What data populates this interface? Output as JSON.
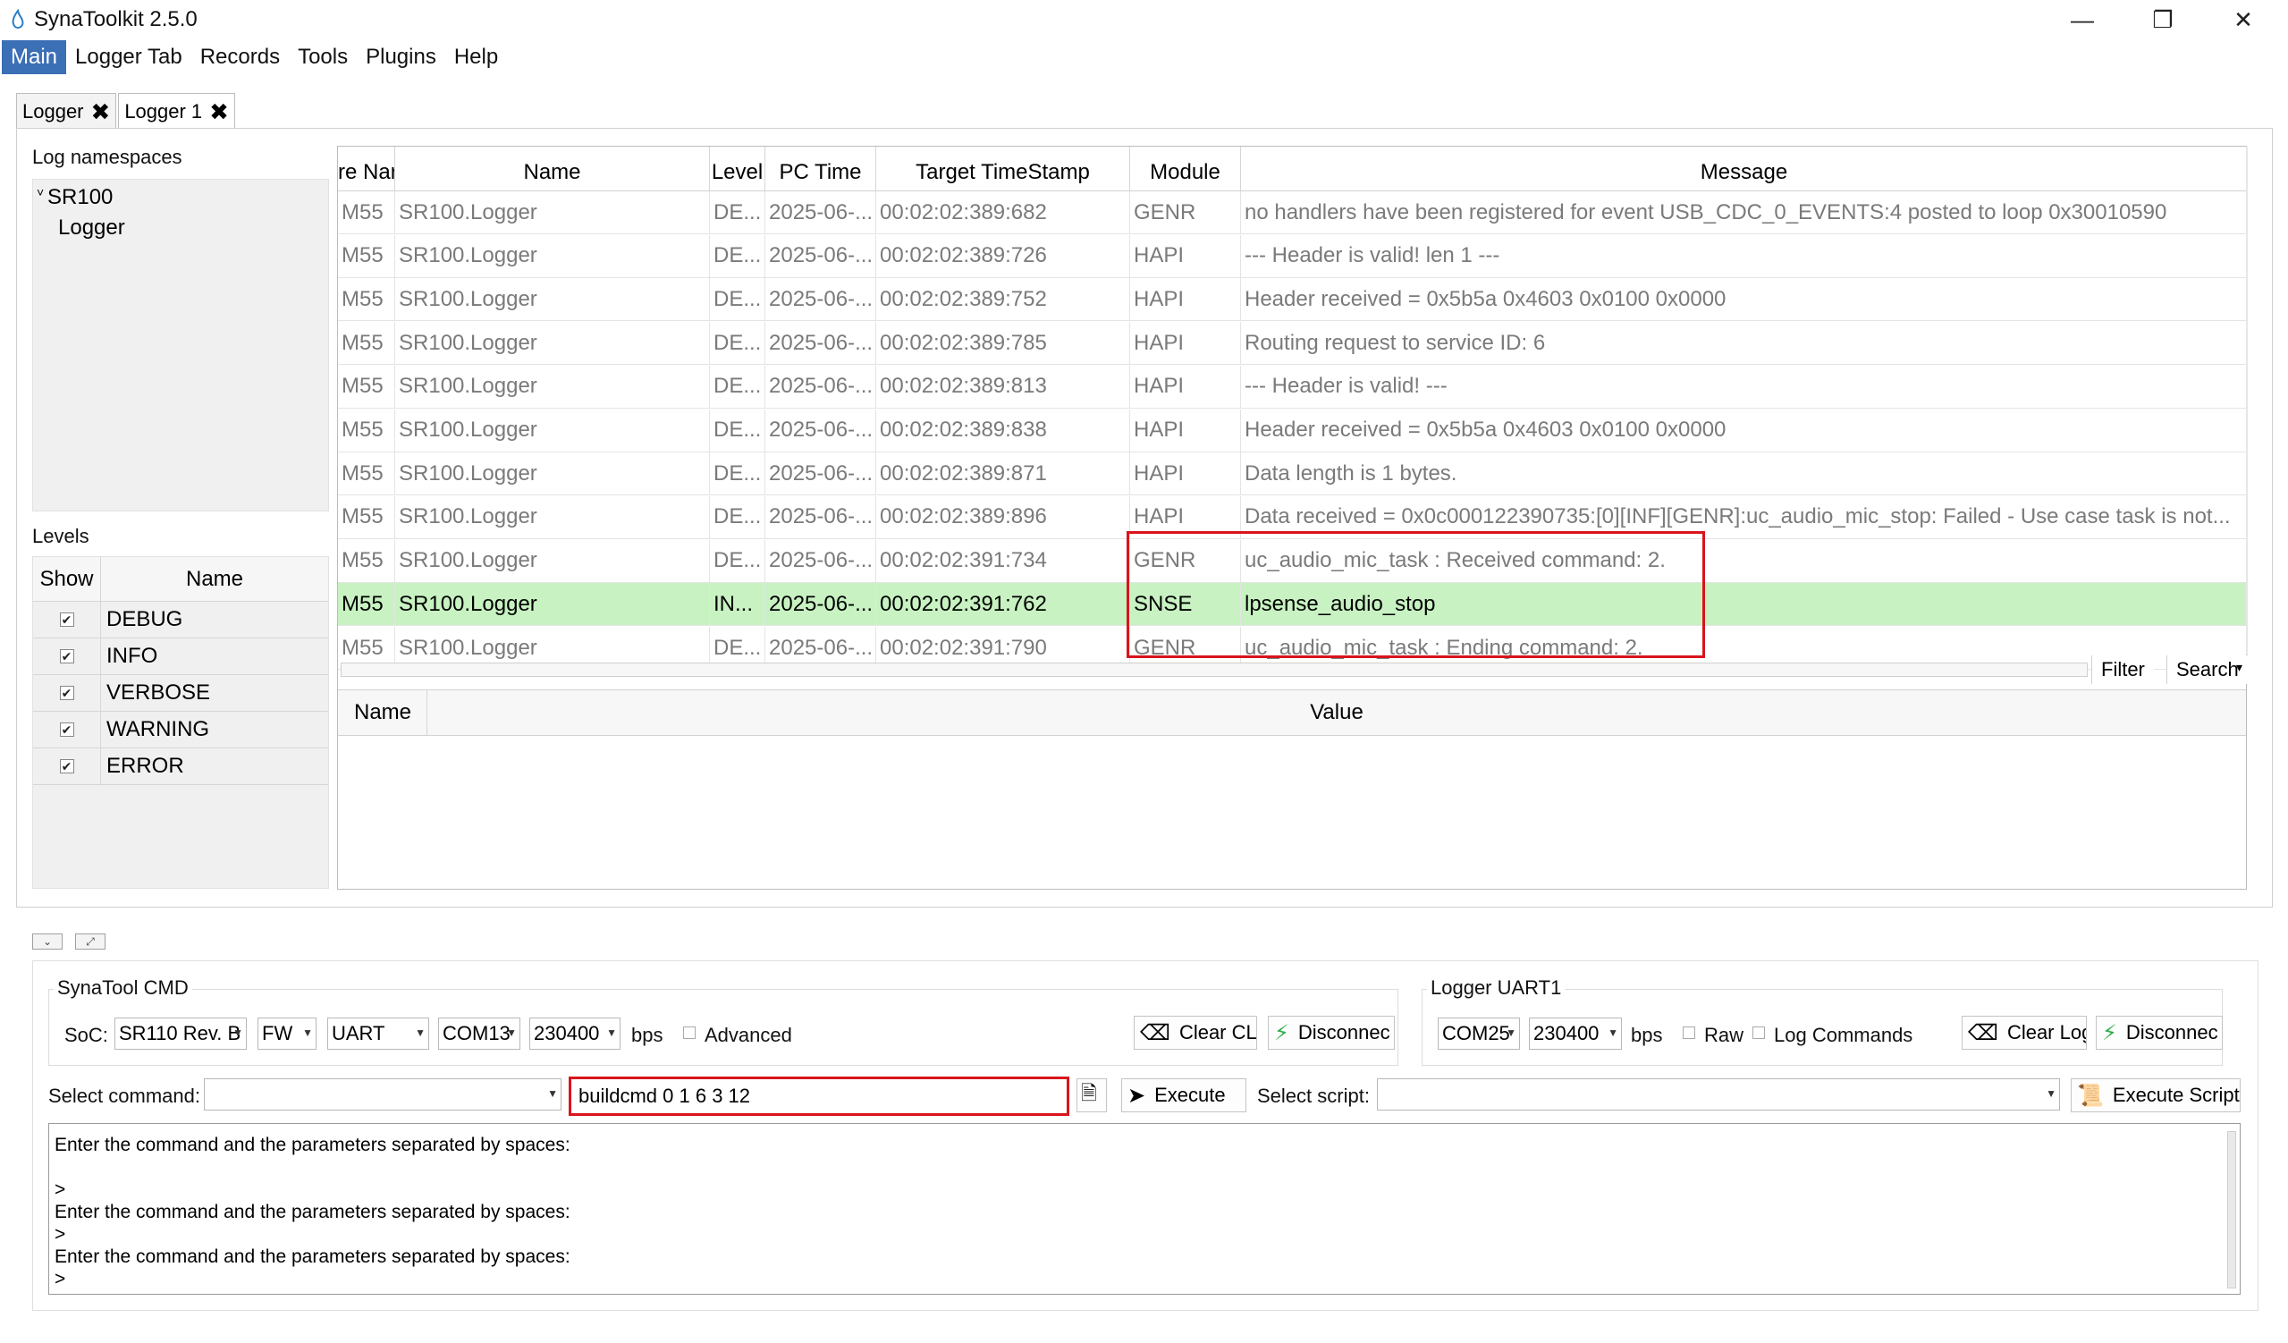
{
  "window": {
    "title": "SynaToolkit 2.5.0",
    "minimize_glyph": "—",
    "maximize_glyph": "❐",
    "close_glyph": "✕"
  },
  "menu": [
    "Main",
    "Logger Tab",
    "Records",
    "Tools",
    "Plugins",
    "Help"
  ],
  "tabs": [
    {
      "label": "Logger",
      "close": "✖"
    },
    {
      "label": "Logger 1",
      "close": "✖"
    }
  ],
  "left": {
    "namespaces_label": "Log namespaces",
    "tree_root": "SR100",
    "tree_child": "Logger",
    "expander": "˅",
    "levels_label": "Levels",
    "levels_headers": {
      "show": "Show",
      "name": "Name"
    },
    "levels": [
      {
        "name": "DEBUG",
        "checked": "✔"
      },
      {
        "name": "INFO",
        "checked": "✔"
      },
      {
        "name": "VERBOSE",
        "checked": "✔"
      },
      {
        "name": "WARNING",
        "checked": "✔"
      },
      {
        "name": "ERROR",
        "checked": "✔"
      }
    ]
  },
  "grid": {
    "headers": [
      "re Nar",
      "Name",
      "Level",
      "PC Time",
      "Target TimeStamp",
      "Module",
      "Message"
    ],
    "rows": [
      [
        "M55",
        "SR100.Logger",
        "DE...",
        "2025-06-...",
        "00:02:02:389:682",
        "GENR",
        "no handlers have been registered for event USB_CDC_0_EVENTS:4 posted to loop 0x30010590"
      ],
      [
        "M55",
        "SR100.Logger",
        "DE...",
        "2025-06-...",
        "00:02:02:389:726",
        "HAPI",
        "--- Header is valid! len 1 ---"
      ],
      [
        "M55",
        "SR100.Logger",
        "DE...",
        "2025-06-...",
        "00:02:02:389:752",
        "HAPI",
        "Header received = 0x5b5a 0x4603 0x0100 0x0000"
      ],
      [
        "M55",
        "SR100.Logger",
        "DE...",
        "2025-06-...",
        "00:02:02:389:785",
        "HAPI",
        "Routing request to service ID: 6"
      ],
      [
        "M55",
        "SR100.Logger",
        "DE...",
        "2025-06-...",
        "00:02:02:389:813",
        "HAPI",
        "--- Header is valid! ---"
      ],
      [
        "M55",
        "SR100.Logger",
        "DE...",
        "2025-06-...",
        "00:02:02:389:838",
        "HAPI",
        "Header received = 0x5b5a 0x4603 0x0100 0x0000"
      ],
      [
        "M55",
        "SR100.Logger",
        "DE...",
        "2025-06-...",
        "00:02:02:389:871",
        "HAPI",
        "Data length is 1 bytes."
      ],
      [
        "M55",
        "SR100.Logger",
        "DE...",
        "2025-06-...",
        "00:02:02:389:896",
        "HAPI",
        "Data received = 0x0c000122390735:[0][INF][GENR]:uc_audio_mic_stop: Failed -  Use case task is not..."
      ],
      [
        "M55",
        "SR100.Logger",
        "DE...",
        "2025-06-...",
        "00:02:02:391:734",
        "GENR",
        "uc_audio_mic_task : Received command: 2."
      ],
      [
        "M55",
        "SR100.Logger",
        "IN...",
        "2025-06-...",
        "00:02:02:391:762",
        "SNSE",
        "lpsense_audio_stop"
      ],
      [
        "M55",
        "SR100.Logger",
        "DE...",
        "2025-06-...",
        "00:02:02:391:790",
        "GENR",
        "uc_audio_mic_task : Ending command: 2."
      ]
    ],
    "selected_row_index": 9,
    "filter_label": "Filter",
    "search_label": "Search",
    "search_arrow": "▾",
    "detail_headers": {
      "name": "Name",
      "value": "Value"
    }
  },
  "bottom": {
    "collapse_glyph": "⌄",
    "expand_glyph": "⤢",
    "synatool_title": "SynaTool CMD",
    "soc_label": "SoC:",
    "soc_value": "SR110 Rev. B",
    "fw_value": "FW",
    "iface_value": "UART",
    "port_value": "COM13",
    "baud_value": "230400",
    "bps": "bps",
    "advanced_label": "Advanced",
    "clear_cli_label": "Clear CLI",
    "disconnect_label": "Disconnec",
    "logger_uart_title": "Logger UART1",
    "logger_port_value": "COM25",
    "logger_baud_value": "230400",
    "logger_bps": "bps",
    "raw_label": "Raw",
    "log_commands_label": "Log Commands",
    "clear_log_label": "Clear Log",
    "logger_disconnect_label": "Disconnec",
    "select_command_label": "Select command:",
    "select_command_value": "",
    "command_input_value": "buildcmd 0 1 6 3 12",
    "execute_label": "Execute",
    "select_script_label": "Select script:",
    "select_script_value": "",
    "execute_script_label": "Execute Script",
    "output_lines": [
      "Enter the command and the parameters separated by spaces:",
      "",
      ">",
      "Enter the command and the parameters separated by spaces:",
      ">",
      "Enter the command and the parameters separated by spaces:",
      ">"
    ]
  },
  "colors": {
    "menu_active": "#3b6fb6",
    "selected_row": "#c8f2c2",
    "highlight_box": "#d9141c"
  }
}
